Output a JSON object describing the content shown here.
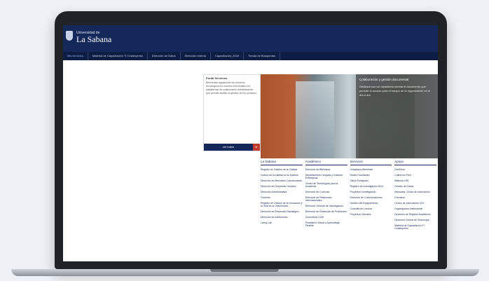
{
  "site": {
    "logo_small": "Universidad de",
    "logo_big": "La Sabana"
  },
  "nav": {
    "items": [
      {
        "label": "Mis servicios",
        "active": true
      },
      {
        "label": "Material de Capacitación TI Ovalexpress",
        "active": false
      },
      {
        "label": "Dirección de Datos",
        "active": false
      },
      {
        "label": "Dirección Interna",
        "active": false
      },
      {
        "label": "Capacitación_2016",
        "active": false
      },
      {
        "label": "Tienda de Búsquedas",
        "active": false
      }
    ]
  },
  "info": {
    "title": "Portal Servicios",
    "text": "Bienvenido agradecido los servicios tecnológicos en nuestra Universidad con plataformas de colaboración administración que permite facilitar la gestión de los procesos.",
    "button_label": "ver todos",
    "button_arrow": "►"
  },
  "overlay": {
    "title": "Colaboración y gestión documental",
    "text": "Gestione con un repositorio central el documento que permite el acceso para el equipo de la organización en el día a día."
  },
  "columns": [
    {
      "heading": "La Sabana",
      "items": [
        "Registro de Gestión de la Calidad",
        "Cultura de la calidad en la Sabana",
        "Dirección de Mercadeo Comunicación",
        "Dirección de Desarrollo Humano",
        "Dirección Administrativa",
        "Fomento",
        "Registro de Gestión de la Educación y la Vida en la Universidad",
        "Dirección de Desarrollo Estratégico",
        "Dirección de Admisiones",
        "Living Lab"
      ]
    },
    {
      "heading": "Académico",
      "items": [
        "Dirección de Biblioteca",
        "Departamento Lenguas y Culturas Extranjeras",
        "Centro de Tecnologías para la Academia",
        "Dirección de Currículo",
        "Dirección de Relaciones Internacionales",
        "Dirección General de Investigación",
        "Dirección de Desarrollo de Profesores",
        "Consultorio CDB",
        "Pluralismo Virtual y Aprendizaje Flexible"
      ]
    },
    {
      "heading": "Servicios",
      "items": [
        "Unisabana Bienestar",
        "Sedes Facultades",
        "Visión Postgrado",
        "Registro de Investigación DDU",
        "Proyectos Investigación",
        "Dirección de Comunicaciones",
        "Gestión del Equipamiento",
        "Consulta de Lectura",
        "Proyectos Virtuales"
      ]
    },
    {
      "heading": "Apoyo",
      "items": [
        "OneDrive",
        "Cultura en Red",
        "Bitácora URL",
        "Gestión de Datos",
        "Manuales, Guías de Información",
        "Formatos",
        "Centro de Información CDI",
        "Organigrama Institucional",
        "Dirección de Registro Académico",
        "Dirección Central de Tecnología",
        "Material de Capacitación TI Ovalexpress"
      ]
    }
  ]
}
